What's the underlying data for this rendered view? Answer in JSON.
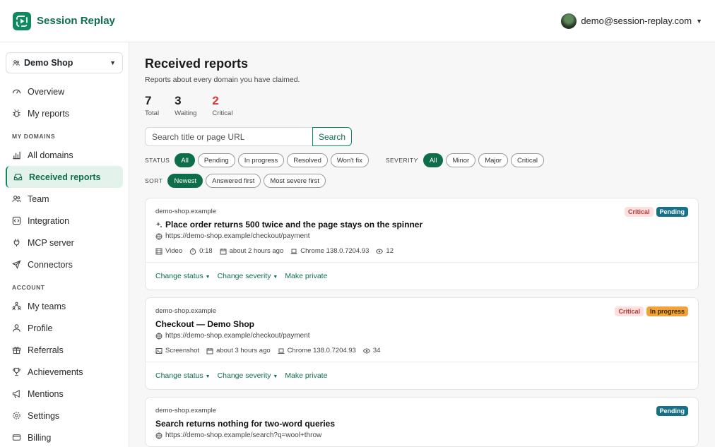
{
  "header": {
    "brand": "Session Replay",
    "user_email": "demo@session-replay.com"
  },
  "sidebar": {
    "shop": "Demo Shop",
    "items_top": [
      {
        "label": "Overview",
        "icon": "gauge-icon"
      },
      {
        "label": "My reports",
        "icon": "bug-icon"
      }
    ],
    "section_domains": "MY DOMAINS",
    "items_domains": [
      {
        "label": "All domains",
        "icon": "bar-chart-icon"
      },
      {
        "label": "Received reports",
        "icon": "inbox-icon",
        "active": true
      },
      {
        "label": "Team",
        "icon": "users-icon"
      },
      {
        "label": "Integration",
        "icon": "code-icon"
      },
      {
        "label": "MCP server",
        "icon": "plug-icon"
      },
      {
        "label": "Connectors",
        "icon": "send-icon"
      }
    ],
    "section_account": "ACCOUNT",
    "items_account": [
      {
        "label": "My teams",
        "icon": "org-icon"
      },
      {
        "label": "Profile",
        "icon": "user-icon"
      },
      {
        "label": "Referrals",
        "icon": "gift-icon"
      },
      {
        "label": "Achievements",
        "icon": "trophy-icon"
      },
      {
        "label": "Mentions",
        "icon": "megaphone-icon"
      },
      {
        "label": "Settings",
        "icon": "gear-icon"
      },
      {
        "label": "Billing",
        "icon": "card-icon"
      }
    ]
  },
  "main": {
    "title": "Received reports",
    "subtitle": "Reports about every domain you have claimed.",
    "stats": [
      {
        "value": "7",
        "label": "Total"
      },
      {
        "value": "3",
        "label": "Waiting"
      },
      {
        "value": "2",
        "label": "Critical"
      }
    ],
    "search": {
      "placeholder": "Search title or page URL",
      "button": "Search"
    },
    "filters": {
      "status_label": "STATUS",
      "status": [
        "All",
        "Pending",
        "In progress",
        "Resolved",
        "Won't fix"
      ],
      "severity_label": "SEVERITY",
      "severity": [
        "All",
        "Minor",
        "Major",
        "Critical"
      ],
      "sort_label": "SORT",
      "sort": [
        "Newest",
        "Answered first",
        "Most severe first"
      ]
    },
    "actions": {
      "status": "Change status",
      "severity": "Change severity",
      "private": "Make private"
    },
    "cards": [
      {
        "domain": "demo-shop.example",
        "title": "Place order returns 500 twice and the page stays on the spinner",
        "url": "https://demo-shop.example/checkout/payment",
        "type": "Video",
        "duration": "0:18",
        "time": "about 2 hours ago",
        "browser": "Chrome 138.0.7204.93",
        "views": "12",
        "badges": [
          "Critical",
          "Pending"
        ]
      },
      {
        "domain": "demo-shop.example",
        "title": "Checkout — Demo Shop",
        "url": "https://demo-shop.example/checkout/payment",
        "type": "Screenshot",
        "time": "about 3 hours ago",
        "browser": "Chrome 138.0.7204.93",
        "views": "34",
        "badges": [
          "Critical",
          "In progress"
        ]
      },
      {
        "domain": "demo-shop.example",
        "title": "Search returns nothing for two-word queries",
        "url": "https://demo-shop.example/search?q=wool+throw",
        "badges": [
          "Pending"
        ]
      }
    ]
  }
}
